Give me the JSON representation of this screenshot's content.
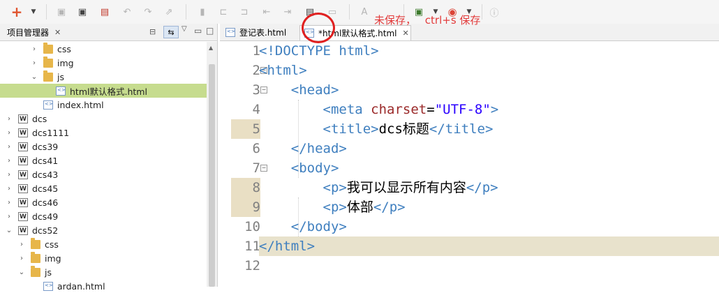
{
  "annotation": {
    "unsaved": "未保存，",
    "shortcut": "ctrl+s 保存"
  },
  "explorer": {
    "title": "项目管理器",
    "tree": [
      {
        "label": "css",
        "kind": "folder",
        "depth": 2,
        "expanded": false
      },
      {
        "label": "img",
        "kind": "folder",
        "depth": 2,
        "expanded": false
      },
      {
        "label": "js",
        "kind": "folder",
        "depth": 2,
        "expanded": true
      },
      {
        "label": "html默认格式.html",
        "kind": "file",
        "depth": 3,
        "selected": true
      },
      {
        "label": "index.html",
        "kind": "file",
        "depth": 2
      },
      {
        "label": "dcs",
        "kind": "project",
        "depth": 0
      },
      {
        "label": "dcs1111",
        "kind": "project",
        "depth": 0
      },
      {
        "label": "dcs39",
        "kind": "project",
        "depth": 0
      },
      {
        "label": "dcs41",
        "kind": "project",
        "depth": 0
      },
      {
        "label": "dcs43",
        "kind": "project",
        "depth": 0
      },
      {
        "label": "dcs45",
        "kind": "project",
        "depth": 0
      },
      {
        "label": "dcs46",
        "kind": "project",
        "depth": 0
      },
      {
        "label": "dcs49",
        "kind": "project",
        "depth": 0
      },
      {
        "label": "dcs52",
        "kind": "project",
        "depth": 0,
        "expanded": true
      },
      {
        "label": "css",
        "kind": "folder",
        "depth": 1
      },
      {
        "label": "img",
        "kind": "folder",
        "depth": 1
      },
      {
        "label": "js",
        "kind": "folder",
        "depth": 1,
        "expanded": true
      },
      {
        "label": "ardan.html",
        "kind": "file",
        "depth": 2
      }
    ]
  },
  "editor": {
    "tabs": [
      {
        "label": "登记表.html",
        "active": false
      },
      {
        "label": "*html默认格式.html",
        "active": true
      }
    ],
    "lines": [
      {
        "n": "1",
        "parts": [
          [
            "t",
            "<!DOCTYPE html>"
          ]
        ]
      },
      {
        "n": "2",
        "parts": [
          [
            "t",
            "<html>"
          ]
        ]
      },
      {
        "n": "3",
        "parts": [
          [
            "x",
            "    "
          ],
          [
            "t",
            "<head>"
          ]
        ]
      },
      {
        "n": "4",
        "parts": [
          [
            "x",
            "        "
          ],
          [
            "t",
            "<meta "
          ],
          [
            "a",
            "charset"
          ],
          [
            "x",
            "="
          ],
          [
            "v",
            "\"UTF-8\""
          ],
          [
            "t",
            ">"
          ]
        ]
      },
      {
        "n": "5",
        "parts": [
          [
            "x",
            "        "
          ],
          [
            "t",
            "<title>"
          ],
          [
            "x",
            "dcs标题"
          ],
          [
            "t",
            "</title>"
          ]
        ]
      },
      {
        "n": "6",
        "parts": [
          [
            "x",
            "    "
          ],
          [
            "t",
            "</head>"
          ]
        ]
      },
      {
        "n": "7",
        "parts": [
          [
            "x",
            "    "
          ],
          [
            "t",
            "<body>"
          ]
        ]
      },
      {
        "n": "8",
        "parts": [
          [
            "x",
            "        "
          ],
          [
            "t",
            "<p>"
          ],
          [
            "x",
            "我可以显示所有内容"
          ],
          [
            "t",
            "</p>"
          ]
        ]
      },
      {
        "n": "9",
        "parts": [
          [
            "x",
            "        "
          ],
          [
            "t",
            "<p>"
          ],
          [
            "x",
            "体部"
          ],
          [
            "t",
            "</p>"
          ]
        ]
      },
      {
        "n": "10",
        "parts": [
          [
            "x",
            "    "
          ],
          [
            "t",
            "</body>"
          ]
        ]
      },
      {
        "n": "11",
        "parts": [
          [
            "t",
            "</html>"
          ]
        ]
      },
      {
        "n": "12",
        "parts": []
      }
    ]
  }
}
